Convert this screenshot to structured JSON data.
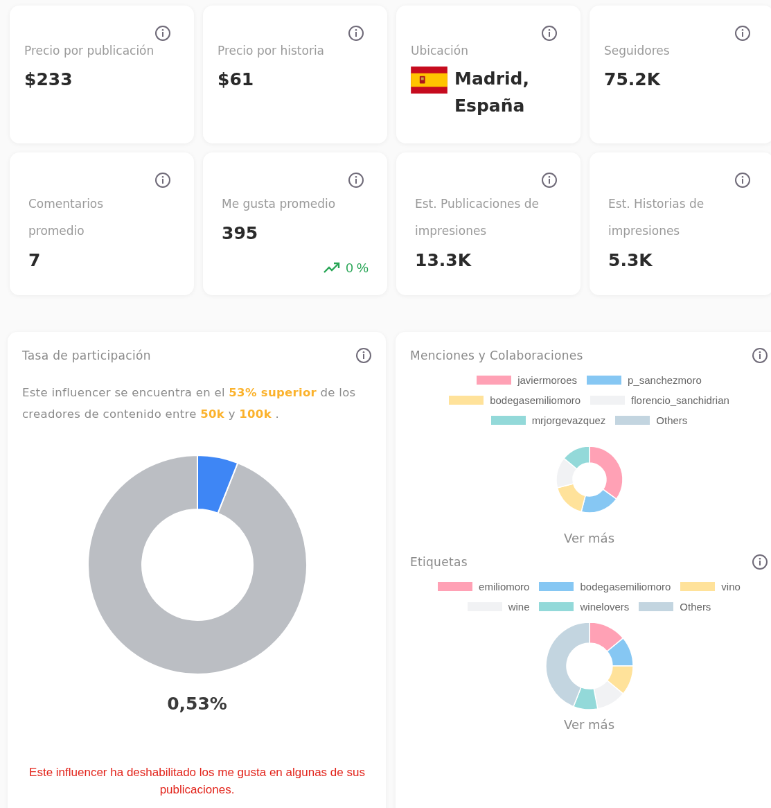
{
  "stats": [
    {
      "kind": "plain",
      "label": "Precio por publicación",
      "value": "$233"
    },
    {
      "kind": "plain",
      "label": "Precio por historia",
      "value": "$61"
    },
    {
      "kind": "location",
      "label": "Ubicación",
      "value": "Madrid, España"
    },
    {
      "kind": "plain",
      "label": "Seguidores",
      "value": "75.2K"
    },
    {
      "kind": "plain",
      "label": "Comentarios promedio",
      "value": "7"
    },
    {
      "kind": "trend",
      "label": "Me gusta promedio",
      "value": "395",
      "trend": "0 %"
    },
    {
      "kind": "plain",
      "label": "Est. Publicaciones de impresiones",
      "value": "13.3K"
    },
    {
      "kind": "plain",
      "label": "Est. Historias de impresiones",
      "value": "5.3K"
    }
  ],
  "participation": {
    "title": "Tasa de participación",
    "description": "Este influencer se encuentra en el **53% superior** de los creadores de contenido entre **50k** y **100k** .",
    "value": "0,53%",
    "warning": "Este influencer ha deshabilitado los me gusta en algunas de sus publicaciones."
  },
  "breakdowns": [
    {
      "title": "Menciones y Colaboraciones",
      "link": "Ver más",
      "legend": [
        {
          "label": "javiermoroes",
          "color": "#ffa1b5"
        },
        {
          "label": "p_sanchezmoro",
          "color": "#86c7f3"
        },
        {
          "label": "bodegasemiliomoro",
          "color": "#ffe29a"
        },
        {
          "label": "florencio_sanchidrian",
          "color": "#f1f2f4"
        },
        {
          "label": "mrjorgevazquez",
          "color": "#93d9d9"
        },
        {
          "label": "Others",
          "color": "#c3d5e0"
        }
      ]
    },
    {
      "title": "Etiquetas",
      "link": "Ver más",
      "legend": [
        {
          "label": "emiliomoro",
          "color": "#ffa1b5"
        },
        {
          "label": "bodegasemiliomoro",
          "color": "#86c7f3"
        },
        {
          "label": "vino",
          "color": "#ffe29a"
        },
        {
          "label": "wine",
          "color": "#f1f2f4"
        },
        {
          "label": "winelovers",
          "color": "#93d9d9"
        },
        {
          "label": "Others",
          "color": "#c3d5e0"
        }
      ]
    }
  ]
}
